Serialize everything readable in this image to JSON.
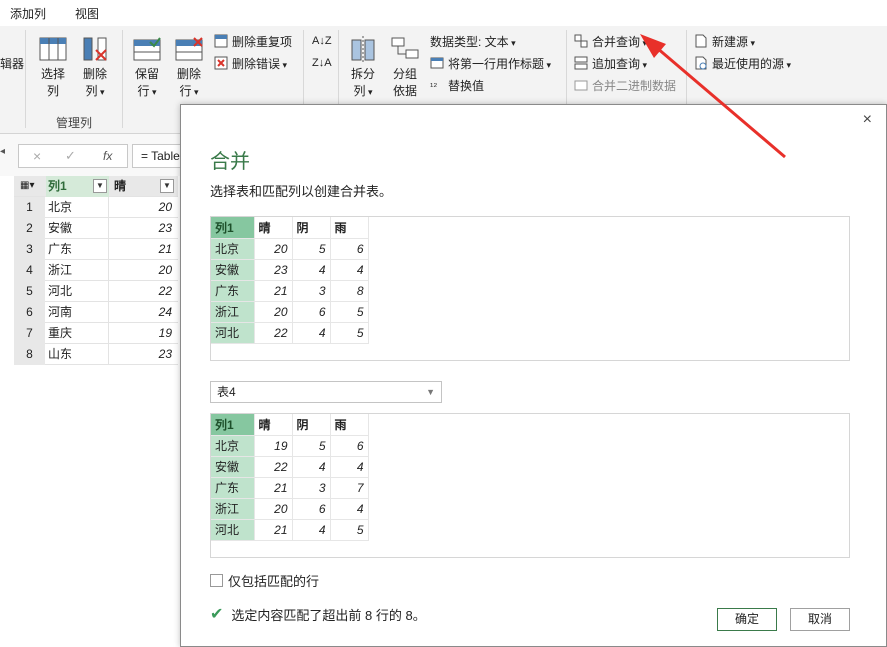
{
  "tabs": [
    "添加列",
    "视图"
  ],
  "ribbon": {
    "edge_label": "辑器",
    "choose_cols": [
      "选择",
      "列"
    ],
    "remove_cols": [
      "删除",
      "列"
    ],
    "group_manage": "管理列",
    "keep_rows": [
      "保留",
      "行"
    ],
    "remove_rows": [
      "删除",
      "行"
    ],
    "remove_duplicates": "删除重复项",
    "remove_errors": "删除错误",
    "split": [
      "拆分",
      "列"
    ],
    "group_by": [
      "分组",
      "依据"
    ],
    "data_type": "数据类型: 文本",
    "first_row_header": "将第一行用作标题",
    "replace_values": "替换值",
    "merge_queries": "合并查询",
    "append_queries": "追加查询",
    "combine_binaries": "合并二进制数据",
    "new_source": "新建源",
    "recent_sources": "最近使用的源"
  },
  "formula": {
    "cancel": "×",
    "confirm": "✓",
    "fx": "fx",
    "text": "= Table"
  },
  "grid": {
    "headers": [
      "列1",
      "晴"
    ],
    "rows": [
      {
        "n": "1",
        "city": "北京",
        "v": "20"
      },
      {
        "n": "2",
        "city": "安徽",
        "v": "23"
      },
      {
        "n": "3",
        "city": "广东",
        "v": "21"
      },
      {
        "n": "4",
        "city": "浙江",
        "v": "20"
      },
      {
        "n": "5",
        "city": "河北",
        "v": "22"
      },
      {
        "n": "6",
        "city": "河南",
        "v": "24"
      },
      {
        "n": "7",
        "city": "重庆",
        "v": "19"
      },
      {
        "n": "8",
        "city": "山东",
        "v": "23"
      }
    ]
  },
  "dialog": {
    "close": "×",
    "title": "合并",
    "description": "选择表和匹配列以创建合并表。",
    "table1": {
      "headers": [
        "列1",
        "晴",
        "阴",
        "雨"
      ],
      "rows": [
        [
          "北京",
          "20",
          "5",
          "6"
        ],
        [
          "安徽",
          "23",
          "4",
          "4"
        ],
        [
          "广东",
          "21",
          "3",
          "8"
        ],
        [
          "浙江",
          "20",
          "6",
          "5"
        ],
        [
          "河北",
          "22",
          "4",
          "5"
        ]
      ]
    },
    "table2_select": "表4",
    "table2": {
      "headers": [
        "列1",
        "晴",
        "阴",
        "雨"
      ],
      "rows": [
        [
          "北京",
          "19",
          "5",
          "6"
        ],
        [
          "安徽",
          "22",
          "4",
          "4"
        ],
        [
          "广东",
          "21",
          "3",
          "7"
        ],
        [
          "浙江",
          "20",
          "6",
          "4"
        ],
        [
          "河北",
          "21",
          "4",
          "5"
        ]
      ]
    },
    "only_matching": "仅包括匹配的行",
    "match_status": "选定内容匹配了超出前 8 行的 8。",
    "ok": "确定",
    "cancel": "取消"
  },
  "colors": {
    "accent_green": "#3a7a4a",
    "header_green": "#86c7a0",
    "cell_green": "#bfe3cc",
    "arrow_red": "#e8302a"
  }
}
